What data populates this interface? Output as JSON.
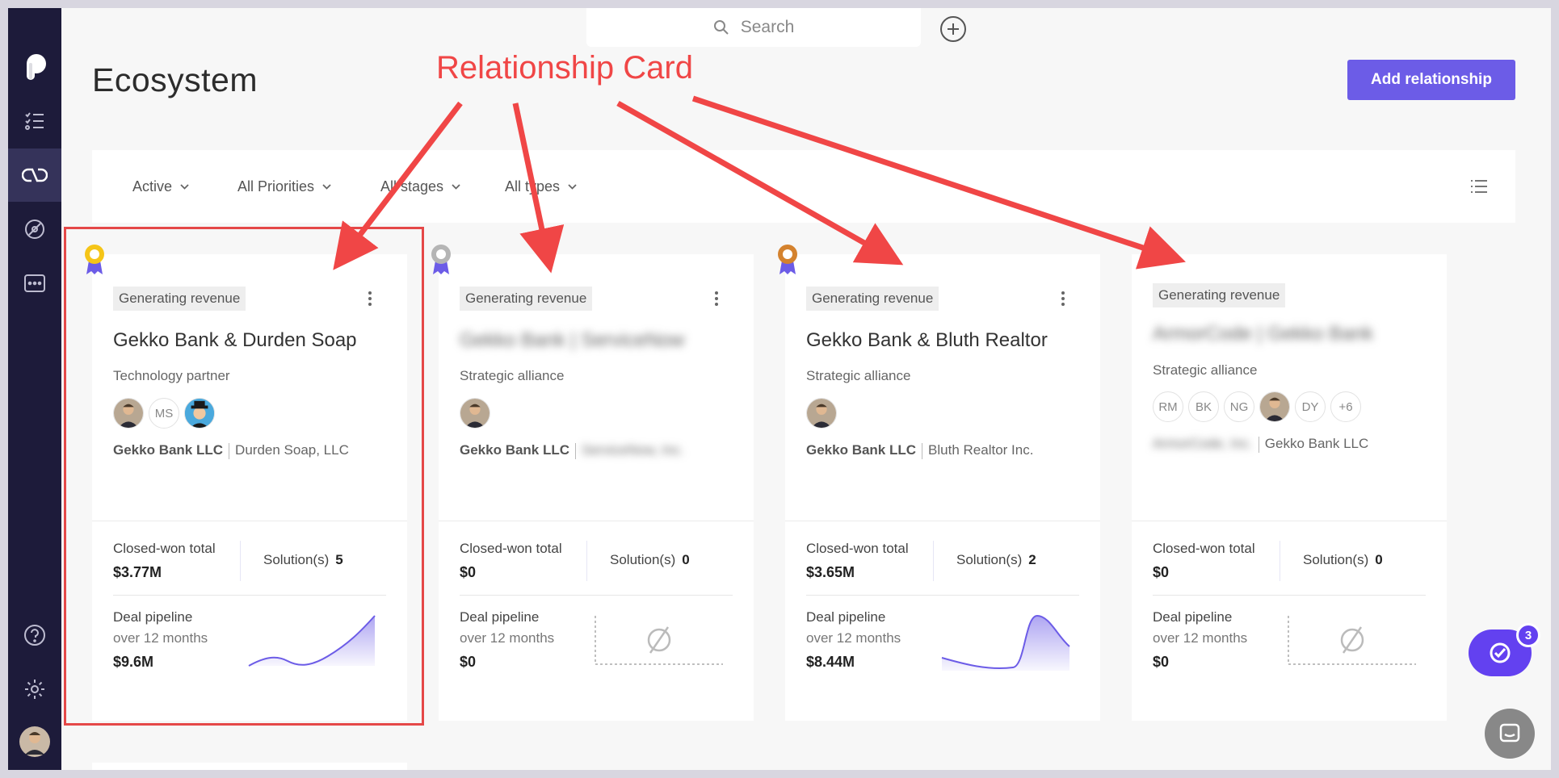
{
  "page": {
    "title": "Ecosystem",
    "search_placeholder": "Search",
    "add_button": "Add relationship"
  },
  "filters": [
    {
      "label": "Active"
    },
    {
      "label": "All Priorities"
    },
    {
      "label": "All stages"
    },
    {
      "label": "All types"
    }
  ],
  "annotation": {
    "label": "Relationship Card",
    "color": "#f04646"
  },
  "cards": [
    {
      "stage": "Generating revenue",
      "title": "Gekko Bank & Durden Soap",
      "type": "Technology partner",
      "avatar_initials": [
        "MS"
      ],
      "company_a": "Gekko Bank LLC",
      "company_b": "Durden Soap, LLC",
      "closed_won_label": "Closed-won total",
      "closed_won_value": "$3.77M",
      "solutions_label": "Solution(s)",
      "solutions_value": "5",
      "pipeline_label": "Deal pipeline",
      "pipeline_sub": "over 12 months",
      "pipeline_value": "$9.6M",
      "medal": "gold"
    },
    {
      "stage": "Generating revenue",
      "title": "Gekko Bank | ServiceNow",
      "type": "Strategic alliance",
      "avatar_initials": [],
      "company_a": "Gekko Bank LLC",
      "company_b": "ServiceNow, Inc.",
      "closed_won_label": "Closed-won total",
      "closed_won_value": "$0",
      "solutions_label": "Solution(s)",
      "solutions_value": "0",
      "pipeline_label": "Deal pipeline",
      "pipeline_sub": "over 12 months",
      "pipeline_value": "$0",
      "medal": "silver"
    },
    {
      "stage": "Generating revenue",
      "title": "Gekko Bank & Bluth Realtor",
      "type": "Strategic alliance",
      "avatar_initials": [],
      "company_a": "Gekko Bank LLC",
      "company_b": "Bluth Realtor Inc.",
      "closed_won_label": "Closed-won total",
      "closed_won_value": "$3.65M",
      "solutions_label": "Solution(s)",
      "solutions_value": "2",
      "pipeline_label": "Deal pipeline",
      "pipeline_sub": "over 12 months",
      "pipeline_value": "$8.44M",
      "medal": "bronze"
    },
    {
      "stage": "Generating revenue",
      "title": "ArmorCode | Gekko Bank",
      "type": "Strategic alliance",
      "avatar_initials": [
        "RM",
        "BK",
        "NG",
        "DY",
        "+6"
      ],
      "company_a": "ArmorCode, Inc.",
      "company_b": "Gekko Bank LLC",
      "closed_won_label": "Closed-won total",
      "closed_won_value": "$0",
      "solutions_label": "Solution(s)",
      "solutions_value": "0",
      "pipeline_label": "Deal pipeline",
      "pipeline_sub": "over 12 months",
      "pipeline_value": "$0",
      "medal": "none"
    }
  ],
  "fab": {
    "badge": "3"
  },
  "colors": {
    "accent": "#6c5ce7",
    "sidebar": "#1d1b3a",
    "annotation": "#f04646"
  }
}
